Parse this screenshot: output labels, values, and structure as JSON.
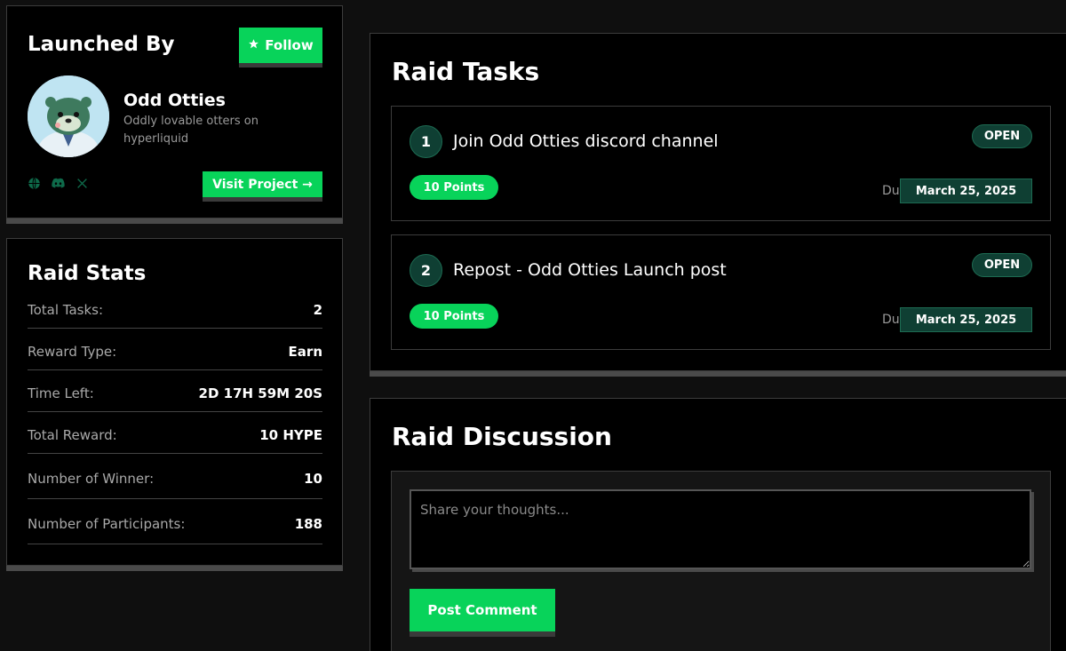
{
  "launched_by": {
    "title": "Launched By",
    "follow_label": "Follow",
    "project_name": "Odd Otties",
    "project_description": "Oddly lovable otters on hyperliquid",
    "visit_label": "Visit Project →",
    "socials": [
      "globe-icon",
      "discord-icon",
      "x-icon"
    ]
  },
  "raid_stats": {
    "title": "Raid Stats",
    "rows": [
      {
        "label": "Total Tasks:",
        "value": "2"
      },
      {
        "label": "Reward Type:",
        "value": "Earn"
      },
      {
        "label": "Time Left:",
        "value": "2D 17H 59M 20S"
      },
      {
        "label": "Total Reward:",
        "value": "10 HYPE"
      },
      {
        "label": "Number of Winner:",
        "value": "10"
      },
      {
        "label": "Number of Participants:",
        "value": "188"
      }
    ]
  },
  "raid_tasks": {
    "title": "Raid Tasks",
    "due_label": "Due:",
    "tasks": [
      {
        "number": "1",
        "title": "Join Odd Otties discord channel",
        "status": "OPEN",
        "points": "10 Points",
        "due": "March 25, 2025"
      },
      {
        "number": "2",
        "title": "Repost - Odd Otties Launch post",
        "status": "OPEN",
        "points": "10 Points",
        "due": "March 25, 2025"
      }
    ]
  },
  "raid_discussion": {
    "title": "Raid Discussion",
    "placeholder": "Share your thoughts...",
    "post_label": "Post Comment"
  },
  "colors": {
    "accent_green": "#08d35a",
    "badge_dark_green": "#0f3f33",
    "background": "#0f0f0f"
  }
}
